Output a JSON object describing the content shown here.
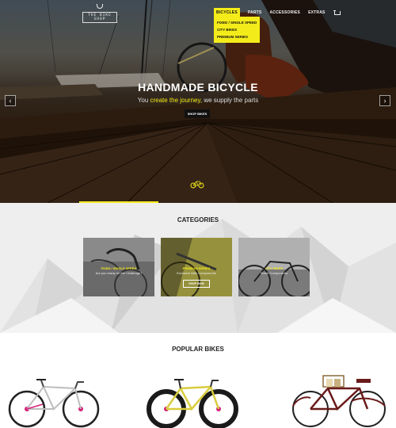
{
  "header": {
    "logo_text": "THE BIKE SHOP",
    "nav": [
      {
        "label": "BICYCLES",
        "active": true
      },
      {
        "label": "PARTS",
        "active": false
      },
      {
        "label": "ACCESSORIES",
        "active": false
      },
      {
        "label": "EXTRAS",
        "active": false
      }
    ],
    "cart_icon": "cart-icon",
    "dropdown": [
      "FIXED / SINGLE SPEED",
      "CITY BIKES",
      "PREMIUM SERIES"
    ]
  },
  "hero": {
    "title": "HANDMADE BICYCLE",
    "subtitle_prefix": "You ",
    "subtitle_highlight": "create the journey,",
    "subtitle_suffix": " we supply the parts",
    "cta": "SHOP BIKES",
    "prev_icon": "chevron-left-icon",
    "next_icon": "chevron-right-icon",
    "accent": "#f4ec1a"
  },
  "categories": {
    "title": "CATEGORIES",
    "items": [
      {
        "label": "FIXED / SINGLE SPEED",
        "desc": "Are you ready for the Challenge?"
      },
      {
        "label": "PREMIUM SERIES",
        "desc": "Exclusive Bike Components",
        "button": "SHOP NOW"
      },
      {
        "label": "CITY BIKES",
        "desc": "Street Components"
      }
    ]
  },
  "popular": {
    "title": "POPULAR BIKES"
  }
}
